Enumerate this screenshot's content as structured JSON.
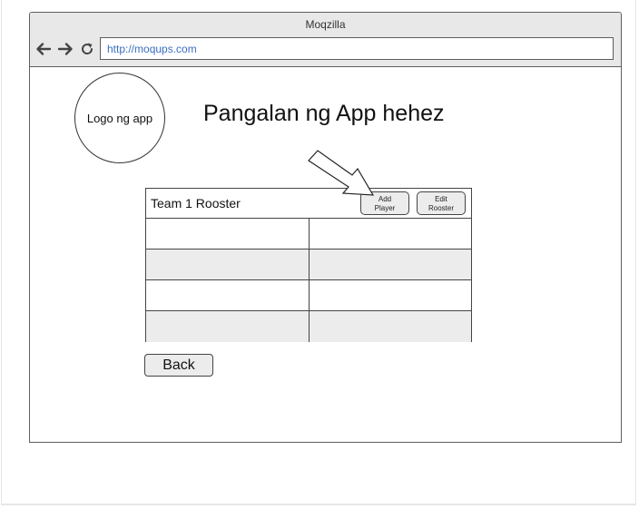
{
  "window": {
    "title": "Moqzilla",
    "url": "http://moqups.com"
  },
  "icons": {
    "back": "arrow-left-icon",
    "forward": "arrow-right-icon",
    "reload": "reload-icon"
  },
  "page": {
    "logo_text": "Logo ng app",
    "app_title": "Pangalan ng App hehez"
  },
  "roster": {
    "title": "Team 1 Rooster",
    "add_player_label": [
      "Add",
      "Player"
    ],
    "edit_roster_label": [
      "Edit",
      "Rooster"
    ],
    "rows": [
      [
        "",
        ""
      ],
      [
        "",
        ""
      ],
      [
        "",
        ""
      ],
      [
        "",
        ""
      ]
    ]
  },
  "back_label": "Back"
}
